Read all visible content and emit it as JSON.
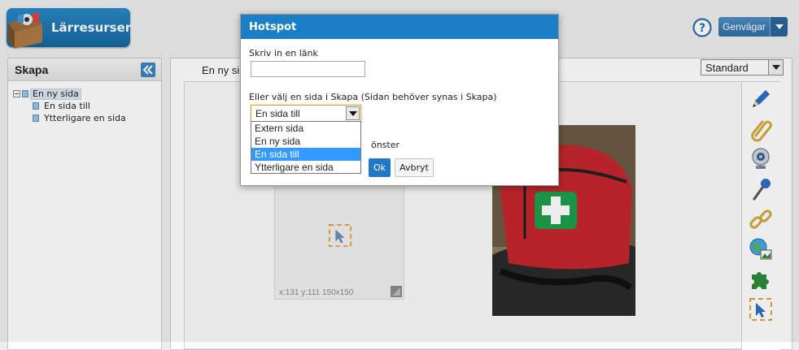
{
  "header": {
    "logo_text": "Lärresurser",
    "shortcuts_label": "Genvägar"
  },
  "sidebar": {
    "title": "Skapa",
    "tree": [
      {
        "label": "En ny sida",
        "selected": true
      },
      {
        "label": "En sida till",
        "selected": false
      },
      {
        "label": "Ytterligare en sida",
        "selected": false
      }
    ]
  },
  "main": {
    "tab_label": "En ny si",
    "style_select_value": "Standard",
    "hotspot_info": "x:131 y:111 150x150"
  },
  "dialog": {
    "title": "Hotspot",
    "link_label": "Skriv in en länk",
    "link_value": "",
    "page_label": "Eller välj en sida i Skapa (Sidan behöver synas i Skapa)",
    "selected_page": "En sida till",
    "window_label_partial": "önster",
    "ok_label": "Ok",
    "cancel_label": "Avbryt",
    "options": [
      "Extern sida",
      "En ny sida",
      "En sida till",
      "Ytterligare en sida"
    ]
  },
  "toolbar_icons": [
    "pencil-icon",
    "paperclip-icon",
    "webcam-icon",
    "microphone-icon",
    "chain-link-icon",
    "globe-image-icon",
    "puzzle-icon",
    "hotspot-cursor-icon"
  ],
  "colors": {
    "brand_blue": "#1c7fc6",
    "selected_option": "#3399ff"
  }
}
